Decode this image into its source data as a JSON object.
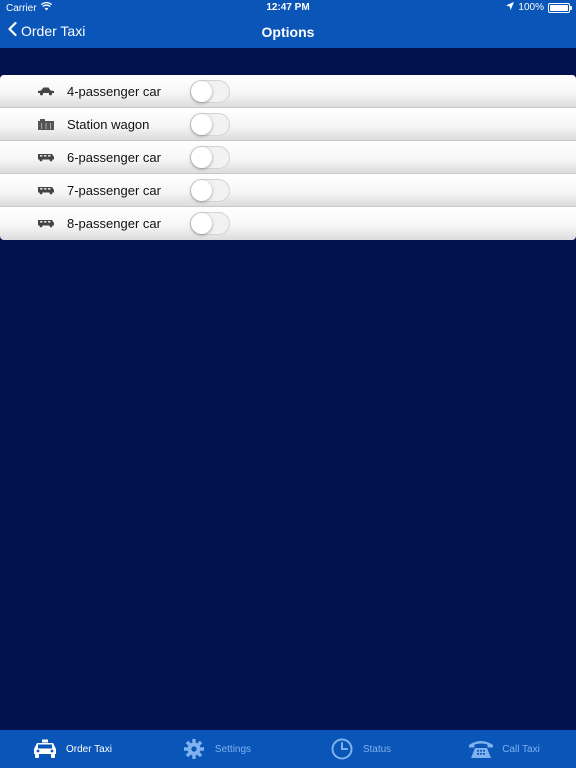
{
  "status_bar": {
    "carrier": "Carrier",
    "time": "12:47 PM",
    "battery": "100%"
  },
  "nav": {
    "back_label": "Order Taxi",
    "title": "Options"
  },
  "options": [
    {
      "label": "4-passenger car",
      "icon": "sedan-icon",
      "enabled": false
    },
    {
      "label": "Station wagon",
      "icon": "station-wagon-icon",
      "enabled": false
    },
    {
      "label": "6-passenger car",
      "icon": "van-icon",
      "enabled": false
    },
    {
      "label": "7-passenger car",
      "icon": "van-icon",
      "enabled": false
    },
    {
      "label": "8-passenger car",
      "icon": "van-icon",
      "enabled": false
    }
  ],
  "tabbar": {
    "tabs": [
      {
        "label": "Order Taxi",
        "icon": "taxi-icon",
        "active": true
      },
      {
        "label": "Settings",
        "icon": "gear-icon",
        "active": false
      },
      {
        "label": "Status",
        "icon": "clock-icon",
        "active": false
      },
      {
        "label": "Call Taxi",
        "icon": "telephone-icon",
        "active": false
      }
    ]
  },
  "colors": {
    "background": "#02124f",
    "bar": "#0a55b8",
    "tab_inactive": "#7fb2ee"
  }
}
